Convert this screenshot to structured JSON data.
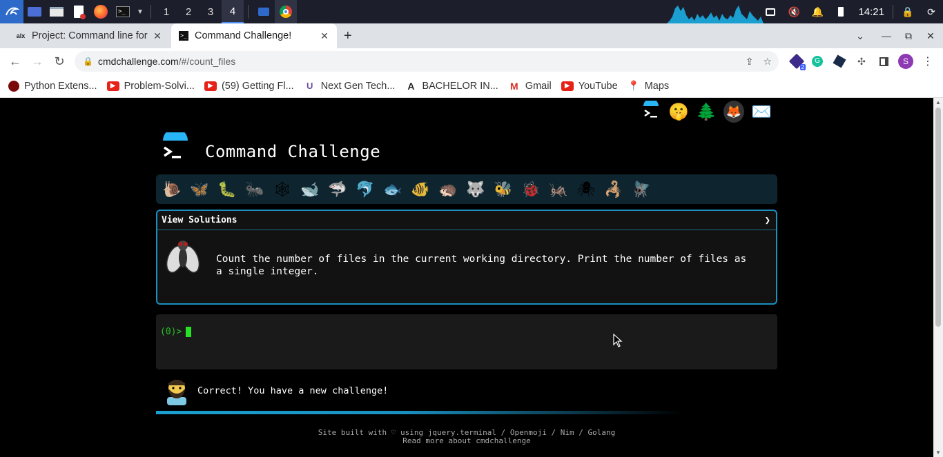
{
  "taskbar": {
    "workspaces": [
      "1",
      "2",
      "3",
      "4"
    ],
    "active_workspace": "4",
    "clock": "14:21"
  },
  "browser": {
    "tabs": [
      {
        "title": "Project: Command line for",
        "favicon": "alx"
      },
      {
        "title": "Command Challenge!",
        "favicon": "terminal"
      }
    ],
    "url_host": "cmdchallenge.com",
    "url_path": "/#/count_files",
    "extension_badge": "2",
    "profile_initial": "S",
    "bookmarks": [
      {
        "label": "Python Extens...",
        "icon": "dark-circle",
        "color": "#a01010"
      },
      {
        "label": "Problem-Solvi...",
        "icon": "youtube",
        "color": "#e62117"
      },
      {
        "label": "(59) Getting Fl...",
        "icon": "youtube",
        "color": "#e62117"
      },
      {
        "label": "Next Gen Tech...",
        "icon": "udacity",
        "color": "#6b4ea0"
      },
      {
        "label": "BACHELOR IN...",
        "icon": "alx",
        "color": "#222222"
      },
      {
        "label": "Gmail",
        "icon": "gmail",
        "color": "#d93025"
      },
      {
        "label": "YouTube",
        "icon": "youtube",
        "color": "#e62117"
      },
      {
        "label": "Maps",
        "icon": "maps",
        "color": "#34a853"
      }
    ]
  },
  "site": {
    "title": "Command Challenge",
    "header_icons": [
      "terminal-icon",
      "shushing-face-icon",
      "tree-icon",
      "gitlab-icon",
      "mail-icon"
    ],
    "levels": [
      "🐌",
      "🦋",
      "🐛",
      "🐜",
      "🕸",
      "🐋",
      "🦈",
      "🐬",
      "🐟",
      "🐠",
      "🦔",
      "🐺",
      "🐝",
      "🐞",
      "🦗",
      "🕷",
      "🦂",
      "🪰"
    ],
    "current_level_index": 17,
    "challenge": {
      "view_solutions_label": "View Solutions",
      "chevron": "❯",
      "description": "Count the number of files in the current working directory. Print the number of files as a single integer."
    },
    "terminal": {
      "prompt": "(0)>"
    },
    "feedback": "Correct! You have a new challenge!",
    "footer": {
      "line1": "Site built with ♡ using jquery.terminal / Openmoji / Nim / Golang",
      "line2": "Read more about cmdchallenge"
    }
  }
}
